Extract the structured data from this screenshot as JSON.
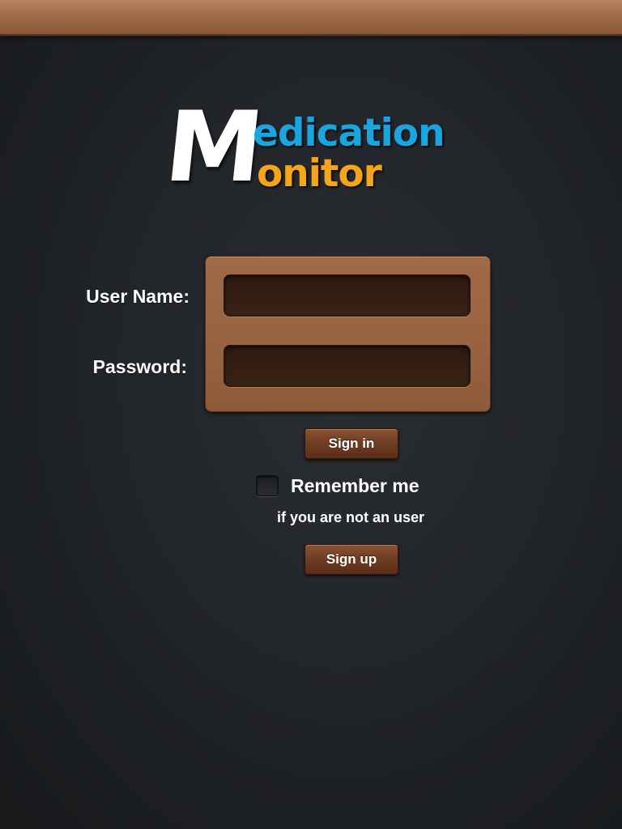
{
  "logo": {
    "big_letter": "M",
    "line1": "edication",
    "line2": "onitor"
  },
  "form": {
    "username_label": "User Name:",
    "username_value": "",
    "password_label": "Password:",
    "password_value": ""
  },
  "actions": {
    "signin_label": "Sign in",
    "remember_label": "Remember me",
    "remember_checked": false,
    "hint": "if you are not an user",
    "signup_label": "Sign up"
  },
  "colors": {
    "logo_blue": "#19a6e0",
    "logo_orange": "#f6a519",
    "leather": "#9a6443",
    "background": "#222529"
  }
}
